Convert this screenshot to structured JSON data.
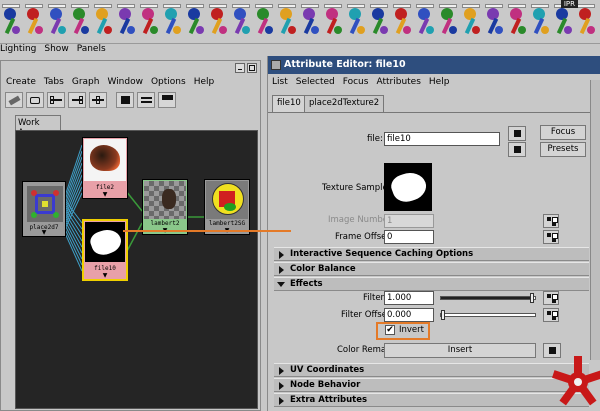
{
  "shelf": {
    "ipr_label": "IPR"
  },
  "main_menu": [
    "Lighting",
    "Show",
    "Panels"
  ],
  "hypershade": {
    "menu": [
      "Create",
      "Tabs",
      "Graph",
      "Window",
      "Options",
      "Help"
    ],
    "tab": "Work Area",
    "nodes": {
      "place2d": "place2d7",
      "file2": "file2",
      "file10": "file10",
      "lambert2": "lambert2",
      "lambert2sg": "lambert2SG"
    }
  },
  "attribute_editor": {
    "title": "Attribute Editor: file10",
    "menu": [
      "List",
      "Selected",
      "Focus",
      "Attributes",
      "Help"
    ],
    "tabs": [
      "file10",
      "place2dTexture2"
    ],
    "file_label": "file:",
    "file_value": "file10",
    "focus_label": "Focus",
    "presets_label": "Presets",
    "texture_sample_label": "Texture Sample",
    "image_number_label": "Image Number",
    "image_number_value": "1",
    "frame_offset_label": "Frame Offset",
    "frame_offset_value": "0",
    "sections": {
      "caching": "Interactive Sequence Caching Options",
      "color_balance": "Color Balance",
      "effects": "Effects",
      "uv": "UV Coordinates",
      "node_behavior": "Node Behavior",
      "extra": "Extra Attributes"
    },
    "filter_label": "Filter",
    "filter_value": "1.000",
    "filter_fraction": 0.98,
    "filter_offset_label": "Filter Offset",
    "filter_offset_value": "0.000",
    "filter_offset_fraction": 0.0,
    "invert_label": "Invert",
    "invert_checked": true,
    "color_remap_label": "Color Remap",
    "insert_label": "Insert"
  },
  "colors": {
    "highlight": "#e47a28",
    "title_bar": "#2e4e7e",
    "canvas": "#252525"
  }
}
